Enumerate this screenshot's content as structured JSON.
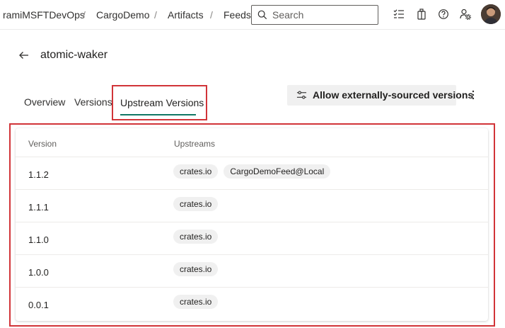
{
  "breadcrumb": [
    "ramiMSFTDevOps",
    "CargoDemo",
    "Artifacts",
    "Feeds"
  ],
  "search": {
    "placeholder": "Search",
    "value": ""
  },
  "topbar_icons": [
    "task-list-icon",
    "package-icon",
    "help-icon",
    "user-settings-icon"
  ],
  "package": {
    "title": "atomic-waker"
  },
  "tabs": [
    {
      "label": "Overview",
      "active": false
    },
    {
      "label": "Versions",
      "active": false
    },
    {
      "label": "Upstream Versions",
      "active": true
    }
  ],
  "actions": {
    "allow_label": "Allow externally-sourced versions"
  },
  "table": {
    "columns": [
      "Version",
      "Upstreams"
    ],
    "rows": [
      {
        "version": "1.1.2",
        "upstreams": [
          "crates.io",
          "CargoDemoFeed@Local"
        ]
      },
      {
        "version": "1.1.1",
        "upstreams": [
          "crates.io"
        ]
      },
      {
        "version": "1.1.0",
        "upstreams": [
          "crates.io"
        ]
      },
      {
        "version": "1.0.0",
        "upstreams": [
          "crates.io"
        ]
      },
      {
        "version": "0.0.1",
        "upstreams": [
          "crates.io"
        ]
      }
    ]
  },
  "colors": {
    "highlight": "#d13438",
    "accent": "#117865",
    "pill_bg": "#f0f0f0"
  }
}
